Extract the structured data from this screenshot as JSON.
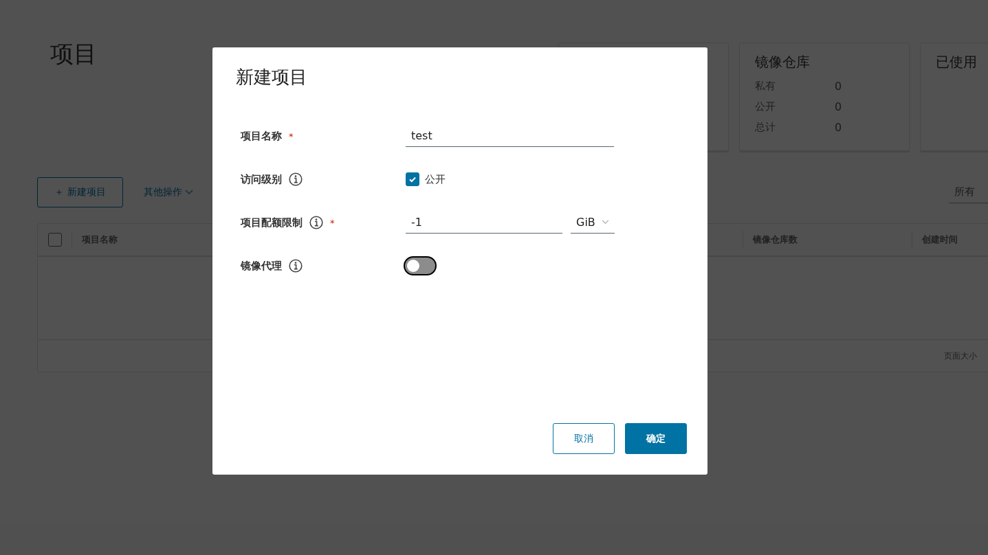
{
  "page": {
    "title": "项目"
  },
  "stat_cards": [
    {
      "title": "镜像仓库",
      "rows": [
        {
          "label": "私有",
          "value": "0"
        },
        {
          "label": "公开",
          "value": "0"
        },
        {
          "label": "总计",
          "value": "0"
        }
      ]
    },
    {
      "title": "已使用"
    }
  ],
  "toolbar": {
    "new_button": {
      "icon": "＋",
      "label": "新建项目"
    },
    "more_actions": "其他操作",
    "filter": "所有"
  },
  "table": {
    "select_all_checked": false,
    "columns": [
      "项目名称",
      "镜像仓库数",
      "创建时间"
    ],
    "footer": "页面大小"
  },
  "dialog": {
    "title": "新建项目",
    "fields": [
      {
        "kind": "text",
        "label": "项目名称",
        "info": false,
        "required_mark": "*",
        "value": "test"
      },
      {
        "kind": "checkbox",
        "label": "访问级别",
        "info": true,
        "option": "公开",
        "checked": true
      },
      {
        "kind": "quota",
        "label": "项目配额限制",
        "info": true,
        "required_mark": "*",
        "value": "-1",
        "unit": "GiB"
      },
      {
        "kind": "toggle",
        "label": "镜像代理",
        "info": true,
        "on": false
      }
    ],
    "buttons": [
      {
        "label": "取消",
        "primary": false
      },
      {
        "label": "确定",
        "primary": true
      }
    ]
  }
}
